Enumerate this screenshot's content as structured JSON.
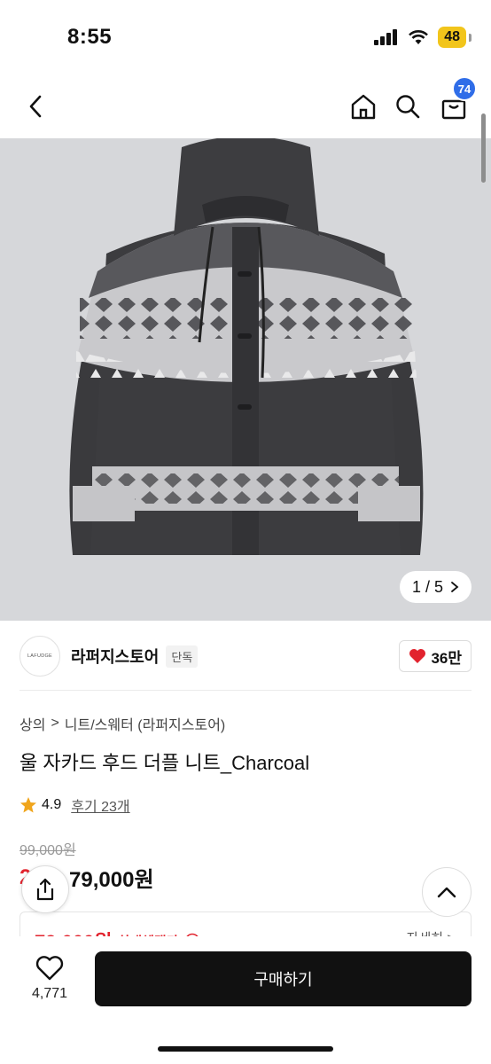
{
  "status": {
    "time": "8:55",
    "battery": "48"
  },
  "nav": {
    "cart_count": "74"
  },
  "gallery": {
    "counter": "1 / 5"
  },
  "store": {
    "logo_text": "LAFUDGE",
    "name": "라퍼지스토어",
    "badge": "단독",
    "likes": "36만"
  },
  "breadcrumb": {
    "level1": "상의",
    "separator": ">",
    "level2": "니트/스웨터 (라퍼지스토어)"
  },
  "product": {
    "title": "울 자카드 후드 더플 니트_Charcoal",
    "rating": "4.9",
    "reviews": "후기 23개",
    "original_price": "99,000원",
    "discount": "20%",
    "price": "79,000원"
  },
  "benefit": {
    "price": "79,000원",
    "label": "최대혜택가",
    "detail": "자세히 >"
  },
  "bottom": {
    "wish_count": "4,771",
    "buy_label": "구매하기"
  },
  "colors": {
    "accent_red": "#e2232e",
    "badge_blue": "#2f6de8",
    "buy_button": "#111111"
  }
}
